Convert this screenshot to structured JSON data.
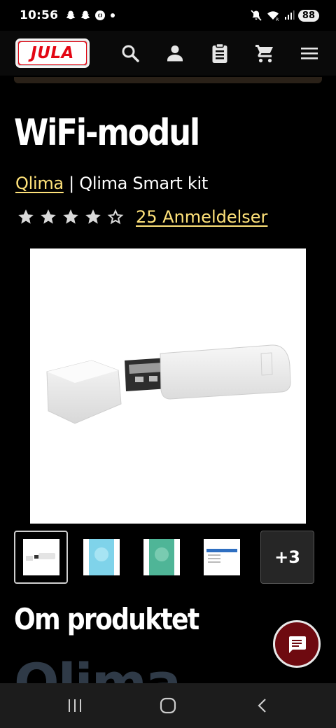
{
  "status_bar": {
    "time": "10:56",
    "battery": "88",
    "left_icons": [
      "snapchat-icon",
      "snapchat-icon",
      "shazam-icon",
      "dot-icon"
    ],
    "right_icons": [
      "mute-icon",
      "wifi-icon",
      "signal-icon",
      "battery-icon"
    ]
  },
  "header": {
    "logo_text": "JULA",
    "icons": [
      "search-icon",
      "account-icon",
      "clipboard-icon",
      "cart-icon",
      "menu-icon"
    ]
  },
  "product": {
    "title": "WiFi-modul",
    "brand_link": "Qlima",
    "separator": " | ",
    "series": "Qlima Smart kit",
    "rating": 4,
    "rating_max": 5,
    "reviews_label": "25 Anmeldelser"
  },
  "gallery": {
    "more_label": "+3",
    "thumbnails": [
      "usb-module",
      "app-screen-blue",
      "app-screen-green",
      "app-screen-list"
    ]
  },
  "about": {
    "title": "Om produktet",
    "brand_heading": "Qlima"
  },
  "colors": {
    "link": "#ffe27a",
    "brand_red": "#e30613",
    "chat_button": "#6e0a10"
  }
}
